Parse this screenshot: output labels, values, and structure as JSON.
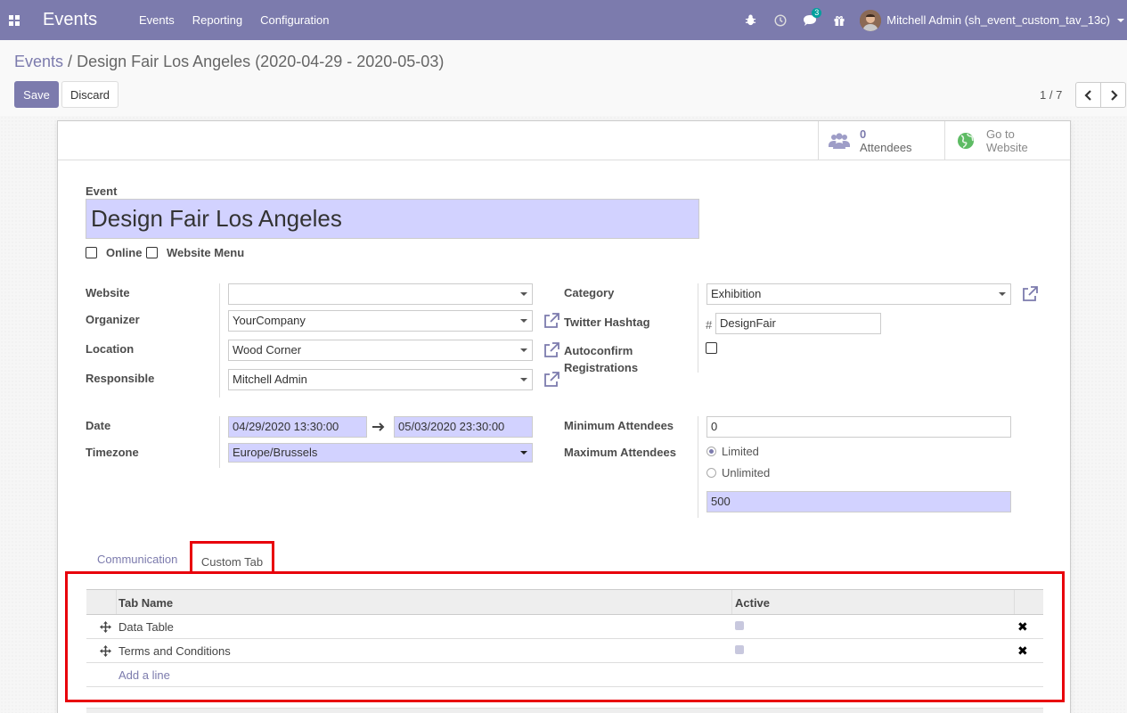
{
  "navbar": {
    "brand": "Events",
    "menu": [
      "Events",
      "Reporting",
      "Configuration"
    ],
    "chat_badge": "3",
    "user_name": "Mitchell Admin (sh_event_custom_tav_13c)"
  },
  "breadcrumb": {
    "parent": "Events",
    "separator": "/",
    "current": "Design Fair Los Angeles (2020-04-29 - 2020-05-03)"
  },
  "toolbar": {
    "save_label": "Save",
    "discard_label": "Discard",
    "pager": "1 / 7"
  },
  "stat_buttons": {
    "attendees_count": "0",
    "attendees_label": "Attendees",
    "website_line1": "Go to",
    "website_line2": "Website"
  },
  "form": {
    "event_label": "Event",
    "event_name": "Design Fair Los Angeles",
    "online_label": "Online",
    "website_menu_label": "Website Menu",
    "website_label": "Website",
    "website_value": "",
    "organizer_label": "Organizer",
    "organizer_value": "YourCompany",
    "location_label": "Location",
    "location_value": "Wood Corner",
    "responsible_label": "Responsible",
    "responsible_value": "Mitchell Admin",
    "category_label": "Category",
    "category_value": "Exhibition",
    "twitter_label": "Twitter Hashtag",
    "twitter_prefix": "#",
    "twitter_value": "DesignFair",
    "autoconfirm_label_1": "Autoconfirm",
    "autoconfirm_label_2": "Registrations",
    "date_label": "Date",
    "date_start": "04/29/2020 13:30:00",
    "date_end": "05/03/2020 23:30:00",
    "timezone_label": "Timezone",
    "timezone_value": "Europe/Brussels",
    "min_att_label": "Minimum Attendees",
    "min_att_value": "0",
    "max_att_label": "Maximum Attendees",
    "limited_label": "Limited",
    "unlimited_label": "Unlimited",
    "max_att_value": "500"
  },
  "tabs": {
    "communication": "Communication",
    "custom": "Custom Tab"
  },
  "custom_table": {
    "col_name": "Tab Name",
    "col_active": "Active",
    "rows": [
      {
        "name": "Data Table"
      },
      {
        "name": "Terms and Conditions"
      }
    ],
    "add_line": "Add a line"
  },
  "colors": {
    "brand": "#7c7bad",
    "required_field": "#d2d2ff",
    "highlight": "#e8000b"
  }
}
